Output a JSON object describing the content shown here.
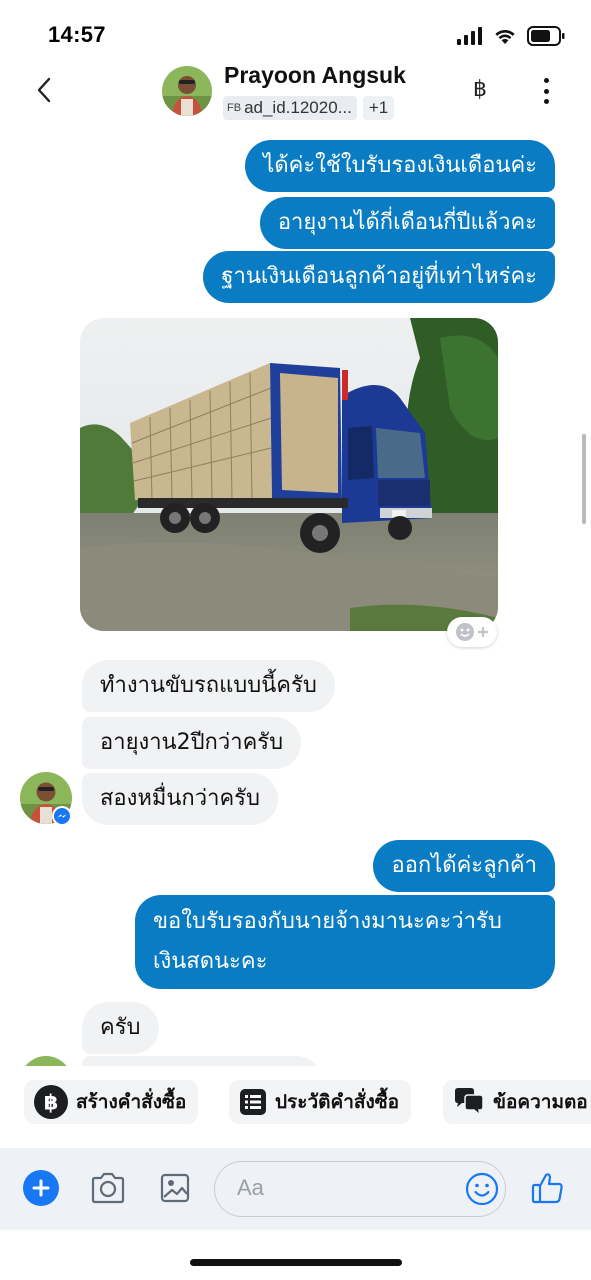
{
  "status_bar": {
    "time": "14:57"
  },
  "header": {
    "contact_name": "Prayoon Angsuk",
    "ad_source_badge": "FB",
    "ad_id": "ad_id.12020...",
    "extra_count": "+1"
  },
  "messages": [
    {
      "direction": "outgoing",
      "text": "ได้ค่ะใช้ใบรับรองเงินเดือนค่ะ"
    },
    {
      "direction": "outgoing",
      "text": "อายุงานได้กี่เดือนกี่ปีแล้วคะ"
    },
    {
      "direction": "outgoing",
      "text": "ฐานเงินเดือนลูกค้าอยู่ที่เท่าไหร่คะ"
    },
    {
      "direction": "outgoing",
      "type": "photo",
      "photo_subject": "blue-cargo-truck"
    },
    {
      "direction": "incoming",
      "text": "ทำงานขับรถแบบนี้ครับ"
    },
    {
      "direction": "incoming",
      "text": "อายุงาน2ปีกว่าครับ"
    },
    {
      "direction": "incoming",
      "text": "สองหมื่นกว่าครับ"
    },
    {
      "direction": "outgoing",
      "text": "ออกได้ค่ะลูกค้า"
    },
    {
      "direction": "outgoing",
      "lines": [
        "ขอใบรับรองกับนายจ้างมานะคะว่ารับ",
        "เงินสดนะคะ"
      ]
    },
    {
      "direction": "incoming",
      "text": "ครับ"
    }
  ],
  "quick_actions": [
    {
      "label": "สร้างคำสั่งซื้อ",
      "icon": "baht-circle-icon"
    },
    {
      "label": "ประวัติคำสั่งซื้อ",
      "icon": "order-list-icon"
    },
    {
      "label": "ข้อความตอ",
      "icon": "chat-bubbles-icon"
    }
  ],
  "composer": {
    "placeholder": "Aa"
  },
  "colors": {
    "outgoing_bubble": "#0a7cc4",
    "incoming_bubble": "#f1f2f4",
    "accent": "#1877f2",
    "composer_bg": "#eef2f6"
  }
}
